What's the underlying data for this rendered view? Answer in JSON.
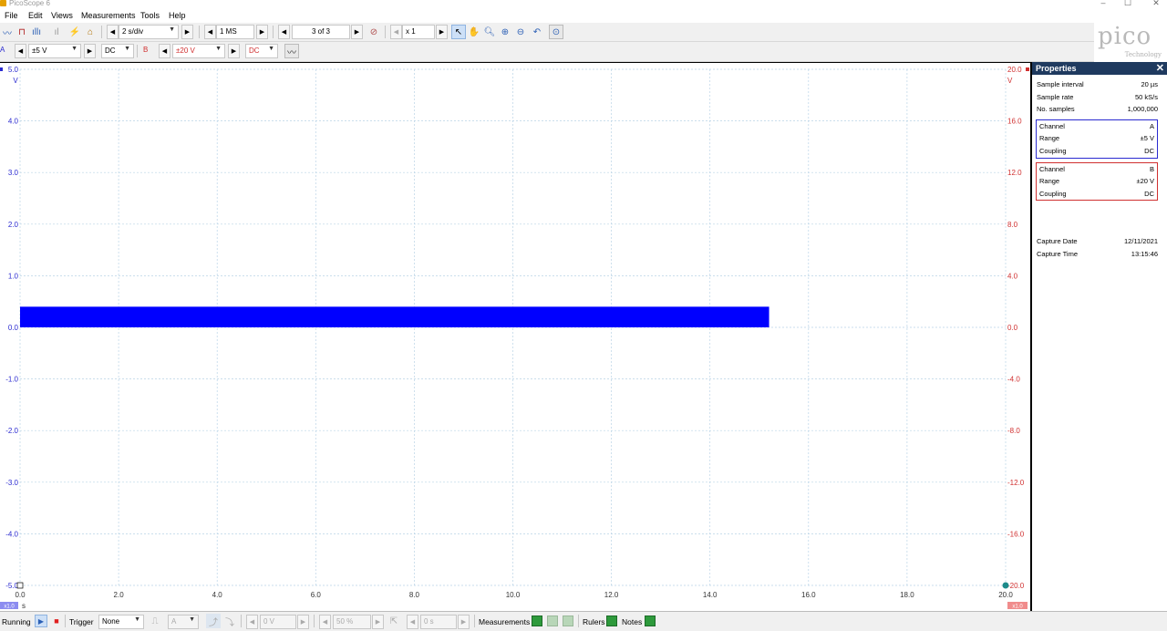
{
  "window": {
    "title": "PicoScope 6",
    "minimize": "–",
    "maximize": "☐",
    "close": "✕"
  },
  "menu": [
    "File",
    "Edit",
    "Views",
    "Measurements",
    "Tools",
    "Help"
  ],
  "toolbar": {
    "timebase": "2 s/div",
    "samples": "1 MS",
    "buffer": "3 of 3",
    "zoom": "x 1"
  },
  "channel_bar": {
    "a_label": "A",
    "a_range": "±5 V",
    "a_coupling": "DC",
    "b_label": "B",
    "b_range": "±20 V",
    "b_coupling": "DC"
  },
  "logo": {
    "word": "pico",
    "sub": "Technology"
  },
  "chart_data": {
    "type": "line",
    "x_label": "s",
    "x_ticks": [
      "0.0",
      "2.0",
      "4.0",
      "6.0",
      "8.0",
      "10.0",
      "12.0",
      "14.0",
      "16.0",
      "18.0",
      "20.0"
    ],
    "xlim": [
      0,
      20
    ],
    "axis_a": {
      "unit": "V",
      "ticks": [
        "5.0",
        "4.0",
        "3.0",
        "2.0",
        "1.0",
        "0.0",
        "-1.0",
        "-2.0",
        "-3.0",
        "-4.0",
        "-5.0"
      ],
      "ylim": [
        -5,
        5
      ]
    },
    "axis_b": {
      "unit": "V",
      "ticks": [
        "20.0",
        "16.0",
        "12.0",
        "8.0",
        "4.0",
        "0.0",
        "-4.0",
        "-8.0",
        "-12.0",
        "-16.0",
        "-20.0"
      ],
      "ylim": [
        -20,
        20
      ]
    },
    "ruler_a": "x1.0",
    "ruler_b": "x1.0",
    "series": [
      {
        "channel": "A",
        "color": "#0000ff",
        "x_start": 0.0,
        "x_end": 15.2,
        "y_min": 0.0,
        "y_max": 0.4
      }
    ],
    "grid": true
  },
  "properties": {
    "title": "Properties",
    "close": "✕",
    "general": [
      {
        "k": "Sample interval",
        "v": "20 µs"
      },
      {
        "k": "Sample rate",
        "v": "50 kS/s"
      },
      {
        "k": "No. samples",
        "v": "1,000,000"
      }
    ],
    "channel_a": [
      {
        "k": "Channel",
        "v": "A"
      },
      {
        "k": "Range",
        "v": "±5 V"
      },
      {
        "k": "Coupling",
        "v": "DC"
      }
    ],
    "channel_b": [
      {
        "k": "Channel",
        "v": "B"
      },
      {
        "k": "Range",
        "v": "±20 V"
      },
      {
        "k": "Coupling",
        "v": "DC"
      }
    ],
    "capture": [
      {
        "k": "Capture Date",
        "v": "12/11/2021"
      },
      {
        "k": "Capture Time",
        "v": "13:15:46"
      }
    ]
  },
  "status": {
    "running": "Running",
    "trigger_label": "Trigger",
    "trigger_mode": "None",
    "trig_channel": "A",
    "trig_level": "0 V",
    "trig_pct": "50 %",
    "trig_delay": "0 s",
    "measurements": "Measurements",
    "rulers": "Rulers",
    "notes": "Notes"
  },
  "colors": {
    "channel_a": "#2a2ad0",
    "channel_b": "#d03030",
    "trace_a": "#0000ff",
    "panel_header": "#1f3a5f"
  }
}
